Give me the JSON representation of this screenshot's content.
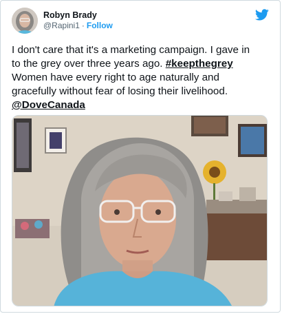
{
  "tweet": {
    "author": {
      "display_name": "Robyn Brady",
      "handle": "@Rapini1",
      "separator": "·",
      "follow_label": "Follow"
    },
    "logo_icon": "twitter-bird-icon",
    "text": {
      "line1": "I don't care that it's a marketing campaign. I gave in",
      "line2_before": "to the grey over three years ago. ",
      "hashtag": "#keepthegrey",
      "line3": "Women have every right to age naturally and",
      "line4": "gracefully without fear of losing their livelihood.",
      "mention": "@DoveCanada"
    },
    "media": {
      "kind": "photo"
    }
  },
  "colors": {
    "accent": "#1d9bf0",
    "text": "#0f1419",
    "muted": "#536471",
    "border": "#cfd9de"
  }
}
